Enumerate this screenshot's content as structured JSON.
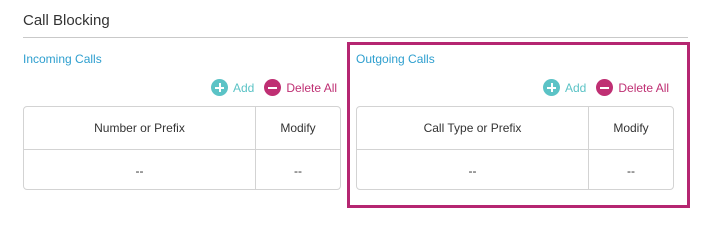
{
  "section": {
    "title": "Call Blocking"
  },
  "incoming": {
    "title": "Incoming Calls",
    "add_label": "Add",
    "delete_all_label": "Delete All",
    "columns": [
      "Number or Prefix",
      "Modify"
    ],
    "rows": [
      [
        "--",
        "--"
      ]
    ]
  },
  "outgoing": {
    "title": "Outgoing Calls",
    "add_label": "Add",
    "delete_all_label": "Delete All",
    "columns": [
      "Call Type or Prefix",
      "Modify"
    ],
    "rows": [
      [
        "--",
        "--"
      ]
    ]
  },
  "colors": {
    "accent_blue": "#2e9fcf",
    "add_teal": "#5bc3c6",
    "delete_magenta": "#bf2f73",
    "highlight_frame": "#b52671"
  },
  "icons": {
    "add": "plus-circle-icon",
    "delete": "minus-circle-icon"
  }
}
